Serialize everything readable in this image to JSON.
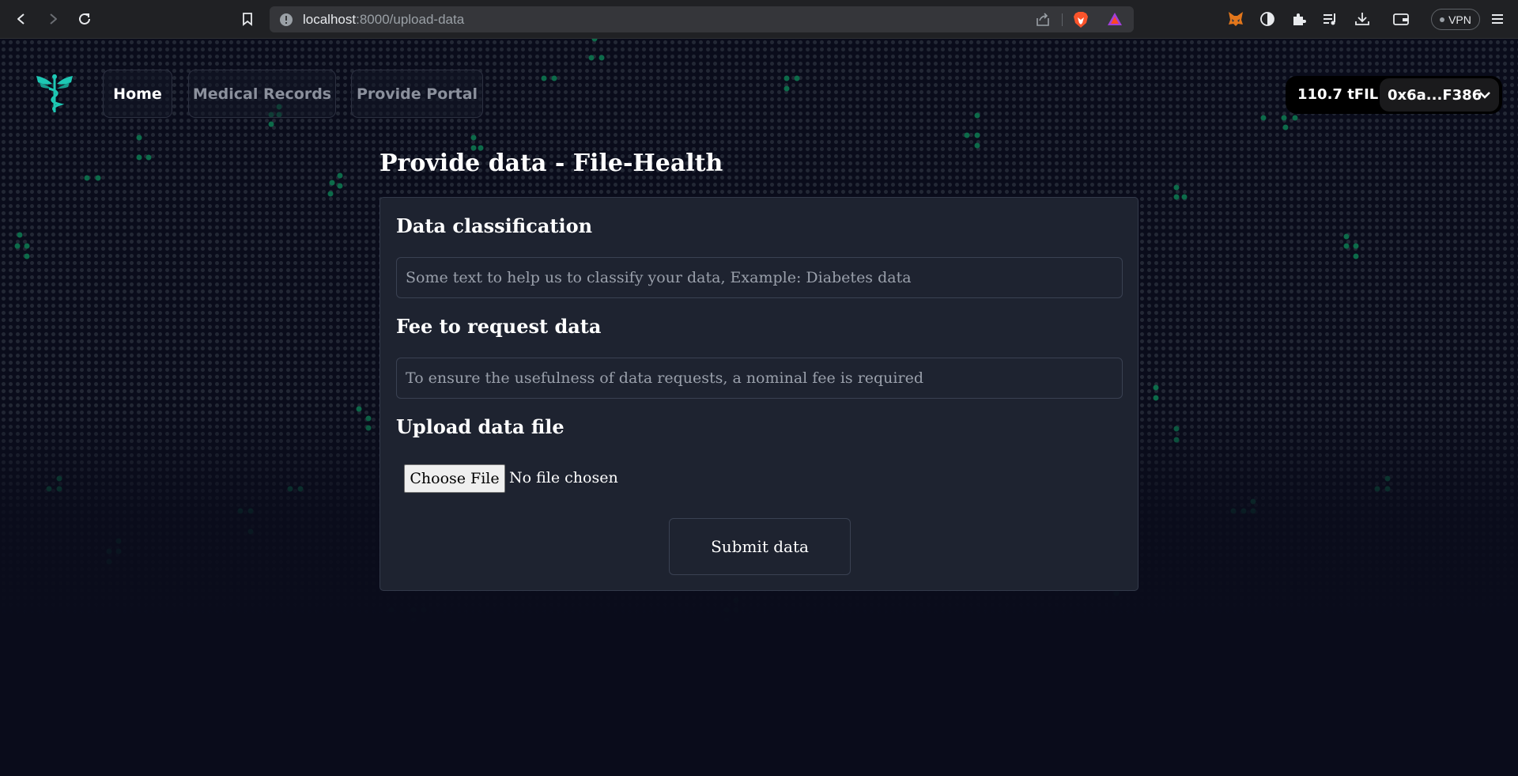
{
  "browser": {
    "url_host": "localhost",
    "url_rest": ":8000/upload-data",
    "vpn_label": "VPN",
    "icons": [
      "back-icon",
      "forward-icon",
      "reload-icon",
      "bookmark-icon",
      "site-info-icon",
      "share-icon",
      "brave-shield-icon",
      "brave-rewards-icon",
      "metamask-icon",
      "extension-icon",
      "puzzle-icon",
      "playlist-icon",
      "download-icon",
      "wallet-icon",
      "menu-icon"
    ]
  },
  "nav": {
    "home": "Home",
    "medical_records": "Medical Records",
    "provide_portal": "Provide Portal"
  },
  "wallet": {
    "balance": "110.7 tFIL",
    "address": "0x6a...F386"
  },
  "page": {
    "title": "Provide data - File-Health"
  },
  "form": {
    "classification_label": "Data classification",
    "classification_placeholder": "Some text to help us to classify your data, Example: Diabetes data",
    "fee_label": "Fee to request data",
    "fee_placeholder": "To ensure the usefulness of data requests, a nominal fee is required",
    "upload_label": "Upload data file",
    "choose_file": "Choose File",
    "no_file": "No file chosen",
    "submit": "Submit data"
  },
  "colors": {
    "background": "#0a0c1b",
    "card": "#1e2330",
    "accent_green": "#0d6b4a",
    "logo_teal": "#1ec8b4"
  }
}
